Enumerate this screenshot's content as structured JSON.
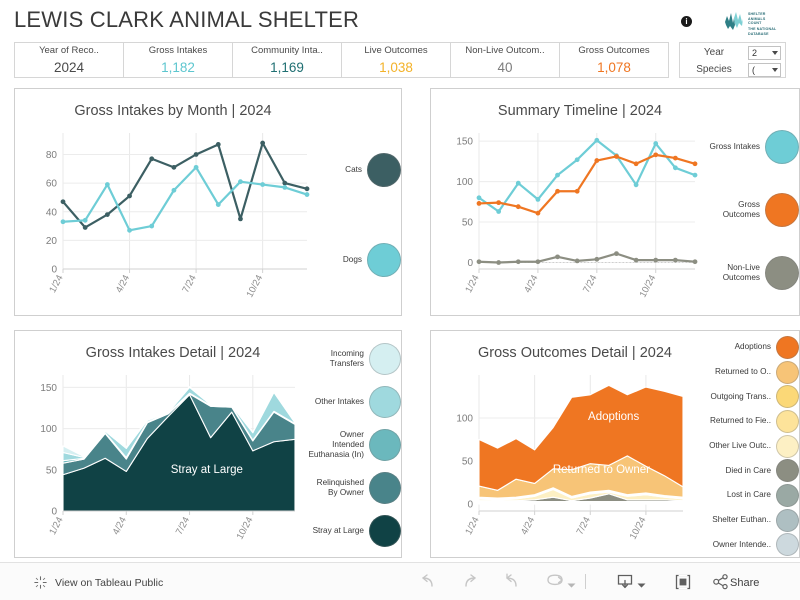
{
  "header": {
    "title": "LEWIS CLARK ANIMAL SHELTER",
    "info_icon": "i",
    "logo": {
      "line1": "SHELTER",
      "line2": "ANIMALS",
      "line3": "COUNT",
      "tagline": "THE NATIONAL DATABASE"
    }
  },
  "kpi": {
    "columns": [
      {
        "header": "Year of Reco..",
        "value": "2024",
        "color": "#4a4a4a"
      },
      {
        "header": "Gross Intakes",
        "value": "1,182",
        "color": "#5dc6cf"
      },
      {
        "header": "Community Inta..",
        "value": "1,169",
        "color": "#1f6f72"
      },
      {
        "header": "Live Outcomes",
        "value": "1,038",
        "color": "#f3b229"
      },
      {
        "header": "Non-Live Outcom..",
        "value": "40",
        "color": "#7d7d7d"
      },
      {
        "header": "Gross Outcomes",
        "value": "1,078",
        "color": "#ef7622"
      }
    ]
  },
  "filters": {
    "year_label": "Year",
    "year_value": "2",
    "species_label": "Species",
    "species_value": "("
  },
  "chart_data": [
    {
      "id": "gross_intakes_by_month",
      "type": "line",
      "title": "Gross Intakes by Month | 2024",
      "xlabel": "",
      "ylabel": "",
      "ylim": [
        0,
        95
      ],
      "yticks": [
        0,
        20,
        40,
        60,
        80
      ],
      "grid": true,
      "legend_position": "right",
      "x": [
        "1/24",
        "2/24",
        "3/24",
        "4/24",
        "5/24",
        "6/24",
        "7/24",
        "8/24",
        "9/24",
        "10/24",
        "11/24",
        "12/24"
      ],
      "tick_labels": [
        "1/24",
        "4/24",
        "7/24",
        "10/24"
      ],
      "series": [
        {
          "name": "Cats",
          "color": "#3c5f63",
          "values": [
            47,
            29,
            38,
            51,
            77,
            71,
            80,
            87,
            35,
            88,
            60,
            56
          ]
        },
        {
          "name": "Dogs",
          "color": "#6ecdd6",
          "values": [
            33,
            34,
            59,
            27,
            30,
            55,
            71,
            45,
            61,
            59,
            57,
            52
          ]
        }
      ]
    },
    {
      "id": "summary_timeline",
      "type": "line",
      "title": "Summary Timeline | 2024",
      "xlabel": "",
      "ylabel": "",
      "ylim": [
        -8,
        160
      ],
      "yticks": [
        0,
        50,
        100,
        150
      ],
      "grid": true,
      "legend_position": "right",
      "x": [
        "1/24",
        "2/24",
        "3/24",
        "4/24",
        "5/24",
        "6/24",
        "7/24",
        "8/24",
        "9/24",
        "10/24",
        "11/24",
        "12/24"
      ],
      "tick_labels": [
        "1/24",
        "4/24",
        "7/24",
        "10/24"
      ],
      "series": [
        {
          "name": "Gross Intakes",
          "color": "#6ecdd6",
          "values": [
            80,
            63,
            98,
            78,
            108,
            127,
            151,
            132,
            96,
            147,
            117,
            108
          ]
        },
        {
          "name": "Gross Outcomes",
          "color": "#ef7622",
          "values": [
            73,
            74,
            69,
            61,
            88,
            88,
            126,
            131,
            122,
            133,
            129,
            122
          ]
        },
        {
          "name": "Non-Live\nOutcomes",
          "color": "#8c8e82",
          "values": [
            1,
            0,
            1,
            1,
            7,
            2,
            4,
            11,
            3,
            3,
            3,
            1
          ]
        }
      ]
    },
    {
      "id": "gross_intakes_detail",
      "type": "area",
      "title": "Gross Intakes Detail | 2024",
      "xlabel": "",
      "ylabel": "",
      "ylim": [
        0,
        165
      ],
      "yticks": [
        0,
        50,
        100,
        150
      ],
      "grid": true,
      "legend_position": "right",
      "stacked": true,
      "inline_label": "Stray at Large",
      "x": [
        "1/24",
        "2/24",
        "3/24",
        "4/24",
        "5/24",
        "6/24",
        "7/24",
        "8/24",
        "9/24",
        "10/24",
        "11/24",
        "12/24"
      ],
      "tick_labels": [
        "1/24",
        "4/24",
        "7/24",
        "10/24"
      ],
      "series": [
        {
          "name": "Stray at Large",
          "color": "#104245",
          "values": [
            44,
            52,
            64,
            48,
            88,
            115,
            141,
            89,
            120,
            73,
            84,
            87
          ]
        },
        {
          "name": "Relinquished\nBy Owner",
          "color": "#49848a",
          "values": [
            14,
            11,
            30,
            15,
            19,
            3,
            1,
            38,
            6,
            12,
            36,
            18
          ]
        },
        {
          "name": "Owner\nIntended\nEuthanasia (In)",
          "color": "#6bb8bd",
          "values": [
            3,
            1,
            1,
            2,
            1,
            1,
            1,
            1,
            1,
            1,
            1,
            1
          ]
        },
        {
          "name": "Other Intakes",
          "color": "#9fd9de",
          "values": [
            10,
            1,
            2,
            11,
            2,
            1,
            7,
            1,
            1,
            9,
            23,
            1
          ]
        },
        {
          "name": "Incoming\nTransfers",
          "color": "#d5eff1",
          "values": [
            8,
            1,
            1,
            2,
            1,
            1,
            1,
            1,
            1,
            1,
            1,
            1
          ]
        }
      ]
    },
    {
      "id": "gross_outcomes_detail",
      "type": "area",
      "title": "Gross Outcomes Detail | 2024",
      "xlabel": "",
      "ylabel": "",
      "ylim": [
        -8,
        150
      ],
      "yticks": [
        0,
        50,
        100
      ],
      "grid": true,
      "legend_position": "right",
      "stacked": true,
      "inline_labels": [
        "Adoptions",
        "Returned to Owner"
      ],
      "x": [
        "1/24",
        "2/24",
        "3/24",
        "4/24",
        "5/24",
        "6/24",
        "7/24",
        "8/24",
        "9/24",
        "10/24",
        "11/24",
        "12/24"
      ],
      "tick_labels": [
        "1/24",
        "4/24",
        "7/24",
        "10/24"
      ],
      "series": [
        {
          "name": "Owner Intende..",
          "color": "#cdd9de",
          "values": [
            1,
            1,
            1,
            1,
            1,
            1,
            1,
            1,
            1,
            1,
            1,
            1
          ]
        },
        {
          "name": "Shelter Euthan..",
          "color": "#aebfc2",
          "values": [
            1,
            1,
            1,
            1,
            1,
            1,
            1,
            1,
            1,
            1,
            1,
            1
          ]
        },
        {
          "name": "Lost in Care",
          "color": "#9aa9a4",
          "values": [
            1,
            1,
            1,
            1,
            1,
            1,
            1,
            1,
            1,
            1,
            1,
            1
          ]
        },
        {
          "name": "Died in Care",
          "color": "#8c8e82",
          "values": [
            1,
            1,
            1,
            2,
            5,
            1,
            4,
            9,
            2,
            2,
            2,
            1
          ]
        },
        {
          "name": "Other Live Outc..",
          "color": "#fdf0c4",
          "values": [
            2,
            1,
            2,
            4,
            9,
            3,
            5,
            2,
            4,
            6,
            3,
            2
          ]
        },
        {
          "name": "Returned to Fie..",
          "color": "#fde39a",
          "values": [
            1,
            1,
            1,
            1,
            1,
            1,
            1,
            1,
            1,
            1,
            1,
            1
          ]
        },
        {
          "name": "Outgoing Trans..",
          "color": "#fbd877",
          "values": [
            1,
            1,
            1,
            1,
            1,
            1,
            1,
            1,
            1,
            1,
            1,
            1
          ]
        },
        {
          "name": "Returned to O..",
          "color": "#f7c477",
          "values": [
            13,
            9,
            21,
            13,
            22,
            31,
            33,
            29,
            45,
            31,
            23,
            12
          ]
        },
        {
          "name": "Adoptions",
          "color": "#ef7622",
          "values": [
            54,
            49,
            47,
            39,
            48,
            84,
            80,
            93,
            71,
            92,
            98,
            105
          ]
        }
      ]
    }
  ],
  "footer": {
    "tableau_link": "View on Tableau Public",
    "share_label": "Share",
    "icons": {
      "undo": "undo-icon",
      "redo": "redo-icon",
      "revert": "revert-icon",
      "refresh": "refresh-icon",
      "download": "download-icon",
      "fullscreen": "fullscreen-icon",
      "share": "share-icon"
    }
  }
}
